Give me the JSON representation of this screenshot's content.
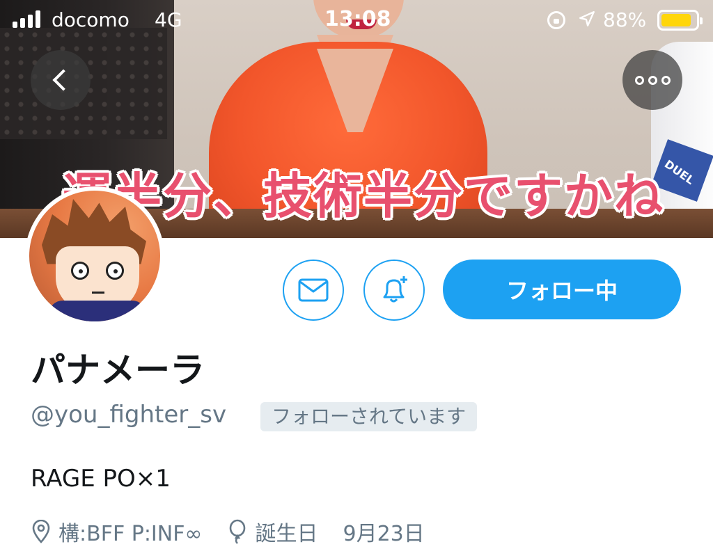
{
  "status_bar": {
    "carrier": "docomo",
    "network": "4G",
    "time": "13:08",
    "battery": "88%",
    "battery_level": 0.88
  },
  "header": {
    "caption": "運半分、技術半分ですかね",
    "armband_text": "DUEL",
    "back_icon": "chevron-left-icon",
    "more_icon": "more-horizontal-icon"
  },
  "profile": {
    "display_name": "パナメーラ",
    "handle": "@you_fighter_sv",
    "follows_you": "フォローされています",
    "bio": "RAGE PO×1",
    "location": "構:BFF P:INF∞",
    "birthday_label": "誕生日",
    "birthday": "9月23日"
  },
  "actions": {
    "dm_icon": "mail-icon",
    "notify_icon": "bell-plus-icon",
    "follow_label": "フォロー中"
  },
  "colors": {
    "accent": "#1da1f2",
    "secondary_text": "#657786",
    "caption_pink": "#e8506e",
    "battery_yellow": "#ffd60a"
  }
}
